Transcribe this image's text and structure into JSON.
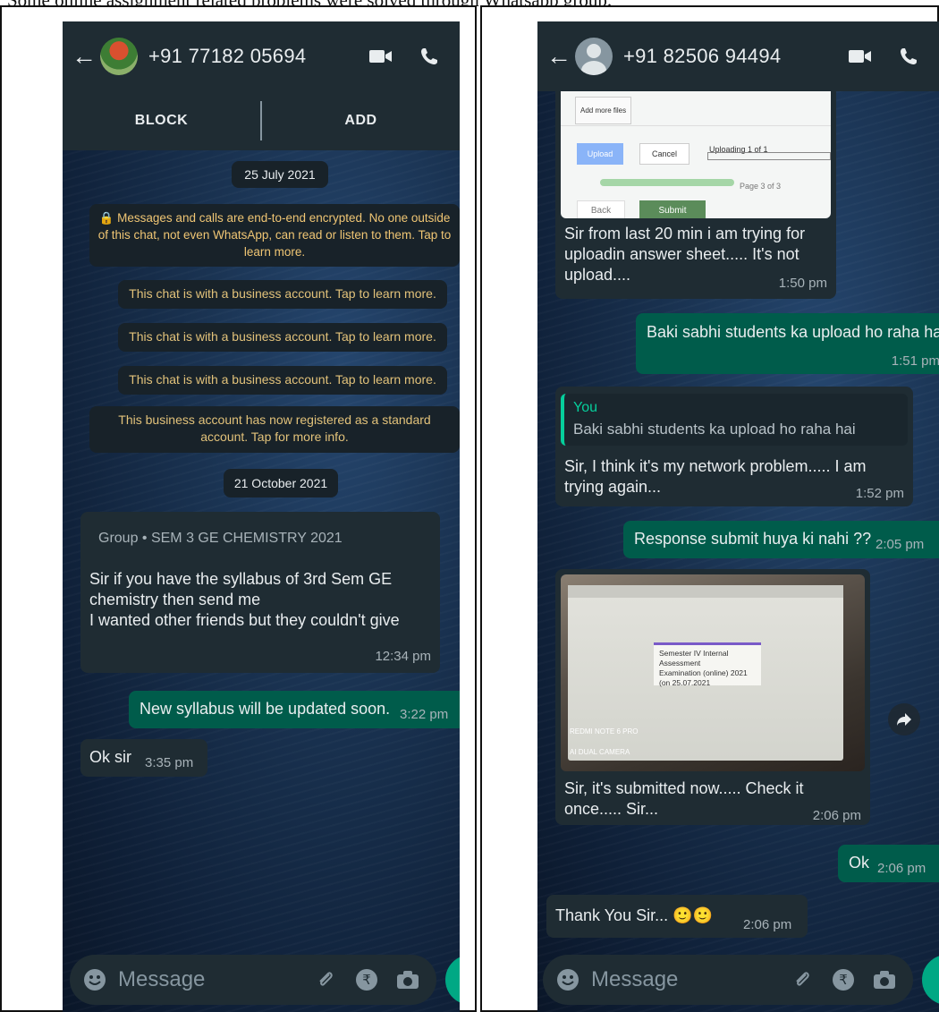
{
  "caption": "Some online assignment related problems were solved through Whatsapp group.",
  "left": {
    "contact": "+91 77182 05694",
    "block_label": "BLOCK",
    "add_label": "ADD",
    "date1": "25 July 2021",
    "encryption_note": "🔒 Messages and calls are end-to-end encrypted. No one outside of this chat, not even WhatsApp, can read or listen to them. Tap to learn more.",
    "business_note": "This chat is with a business account. Tap to learn more.",
    "standard_note": "This business account has now registered as a standard account. Tap for more info.",
    "date2": "21 October 2021",
    "msg1": {
      "group": "Group • SEM 3 GE CHEMISTRY 2021",
      "line1": "Sir if you have the syllabus of 3rd Sem GE",
      "line2": "chemistry then send me",
      "line3": "I wanted other friends but they couldn't give",
      "time": "12:34 pm"
    },
    "msg2": {
      "text": "New syllabus will be updated soon.",
      "time": "3:22 pm"
    },
    "msg3": {
      "text": "Ok sir",
      "time": "3:35 pm"
    },
    "composer_placeholder": "Message"
  },
  "right": {
    "contact": "+91 82506 94494",
    "form": {
      "add_more": "Add more files",
      "upload": "Upload",
      "cancel": "Cancel",
      "uploading": "Uploading 1 of 1",
      "page": "Page 3 of 3",
      "back": "Back",
      "submit": "Submit"
    },
    "msg1": {
      "line1": "Sir from last 20 min i am trying for",
      "line2": "uploadin answer sheet..... It's not",
      "line3": "upload....",
      "time": "1:50 pm"
    },
    "msg2": {
      "text": "Baki sabhi students ka upload ho raha hai",
      "time": "1:51 pm"
    },
    "msg3": {
      "quote_name": "You",
      "quote_text": "Baki sabhi students ka upload ho raha hai",
      "line1": "Sir, I think it's my network problem..... I am",
      "line2": "trying again...",
      "time": "1:52 pm"
    },
    "msg4": {
      "text": "Response submit huya ki nahi ??",
      "time": "2:05 pm"
    },
    "photo": {
      "card_line1": "Semester IV Internal Assessment",
      "card_line2": "Examination (online) 2021 (on 25.07.2021",
      "camera_line1": "REDMI NOTE 6 PRO",
      "camera_line2": "AI DUAL CAMERA"
    },
    "msg5": {
      "line1": "Sir, it's submitted now..... Check it",
      "line2": "once..... Sir...",
      "time": "2:06 pm"
    },
    "msg6": {
      "text": "Ok",
      "time": "2:06 pm"
    },
    "msg7": {
      "text": "Thank You Sir... 🙂🙂",
      "time": "2:06 pm"
    },
    "composer_placeholder": "Message"
  },
  "colors": {
    "header": "#1f2c33",
    "incoming": "#1f2c33",
    "outgoing": "#005c4b",
    "accent": "#00a884",
    "system_text": "#f0c674"
  }
}
